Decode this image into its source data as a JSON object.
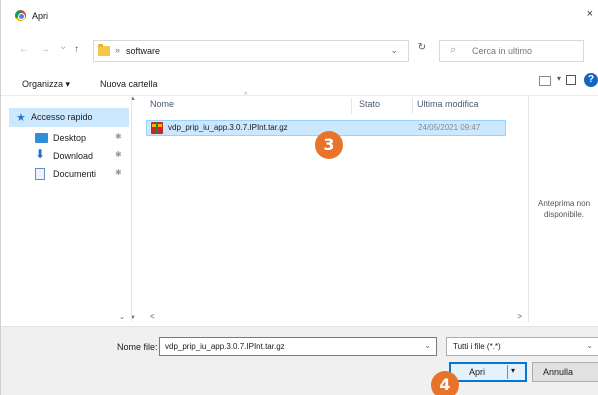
{
  "window": {
    "title": "Apri",
    "close_glyph": "×"
  },
  "nav": {
    "back_glyph": "←",
    "forward_glyph": "→",
    "recent_glyph": "⌄",
    "up_glyph": "↑",
    "breadcrumb_sep": "»",
    "breadcrumb": "software",
    "dropdown_glyph": "⌄",
    "refresh_glyph": "↻",
    "search_icon": "⌕",
    "search_placeholder": "Cerca in ultimo"
  },
  "toolbar": {
    "organize": "Organizza ▾",
    "new_folder": "Nuova cartella",
    "view_dropdown_glyph": "▾",
    "help_glyph": "?"
  },
  "sidebar": {
    "quick_access": "Accesso rapido",
    "pin_glyph": "✱",
    "items": [
      {
        "label": "Desktop",
        "icon": "desktop-icon"
      },
      {
        "label": "Download",
        "icon": "download-icon",
        "glyph": "⬇"
      },
      {
        "label": "Documenti",
        "icon": "documents-icon"
      }
    ]
  },
  "filelist": {
    "columns": [
      "Nome",
      "Stato",
      "Ultima modifica"
    ],
    "sort_glyph": "^",
    "files": [
      {
        "name": "vdp_prip_iu_app.3.0.7.IPInt.tar.gz",
        "status": "",
        "modified": "24/05/2021 09:47",
        "selected": true
      }
    ]
  },
  "preview": {
    "text": "Anteprima non disponibile."
  },
  "scroll": {
    "left_glyph": "<",
    "right_glyph": ">",
    "down_glyph": "⌄"
  },
  "footer": {
    "filename_label": "Nome file:",
    "filename_value": "vdp_prip_iu_app.3.0.7.IPInt.tar.gz",
    "filename_dropdown_glyph": "⌄",
    "filter_value": "Tutti i file (*.*)",
    "filter_dropdown_glyph": "⌄",
    "open_label": "Apri",
    "open_arrow_glyph": "▾",
    "cancel_label": "Annulla"
  },
  "callouts": [
    "3",
    "4"
  ],
  "colors": {
    "accent": "#0078d7",
    "selection": "#cce8ff",
    "callout": "#e8732a"
  }
}
